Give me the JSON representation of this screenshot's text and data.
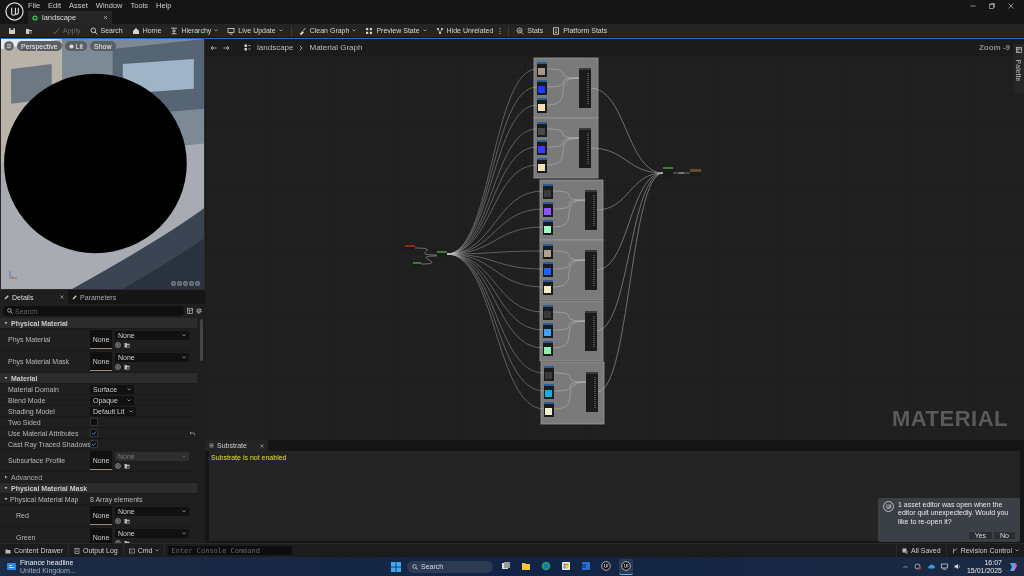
{
  "menu": [
    "File",
    "Edit",
    "Asset",
    "Window",
    "Tools",
    "Help"
  ],
  "document_tab": {
    "label": "landscape",
    "selected": true
  },
  "toolbar": [
    {
      "label": "Apply",
      "disabled": true,
      "dropdown": false,
      "separator_before": false
    },
    {
      "label": "Search",
      "disabled": false,
      "dropdown": false,
      "separator_before": false
    },
    {
      "label": "Home",
      "disabled": false,
      "dropdown": false,
      "separator_before": false
    },
    {
      "label": "Hierarchy",
      "disabled": false,
      "dropdown": true,
      "separator_before": false
    },
    {
      "label": "Live Update",
      "disabled": false,
      "dropdown": true,
      "separator_before": false
    },
    {
      "label": "Clean Graph",
      "disabled": false,
      "dropdown": true,
      "separator_before": true
    },
    {
      "label": "Preview State",
      "disabled": false,
      "dropdown": true,
      "separator_before": false
    },
    {
      "label": "Hide Unrelated",
      "disabled": false,
      "dropdown": false,
      "separator_before": false
    },
    {
      "label": "Stats",
      "disabled": false,
      "dropdown": false,
      "separator_before": true
    },
    {
      "label": "Platform Stats",
      "disabled": false,
      "dropdown": false,
      "separator_before": false
    }
  ],
  "viewport": {
    "buttons": [
      "Perspective",
      "Lit",
      "Show"
    ]
  },
  "details": {
    "tabs": [
      {
        "label": "Details",
        "selected": true
      },
      {
        "label": "Parameters",
        "selected": false
      }
    ],
    "search": {
      "placeholder": "Search"
    },
    "rows": [
      {
        "kind": "section",
        "label": "Physical Material",
        "expanded": true
      },
      {
        "kind": "asset",
        "label": "Phys Material",
        "thumb": "None",
        "value": "None",
        "disabled": false
      },
      {
        "kind": "asset",
        "label": "Phys Material Mask",
        "thumb": "None",
        "value": "None",
        "disabled": false
      },
      {
        "kind": "section",
        "label": "Material",
        "expanded": true
      },
      {
        "kind": "dropdown",
        "label": "Material Domain",
        "value": "Surface"
      },
      {
        "kind": "dropdown",
        "label": "Blend Mode",
        "value": "Opaque"
      },
      {
        "kind": "dropdown",
        "label": "Shading Model",
        "value": "Default Lit"
      },
      {
        "kind": "checkbox",
        "label": "Two Sided",
        "checked": false,
        "modified": false
      },
      {
        "kind": "checkbox",
        "label": "Use Material Attributes",
        "checked": true,
        "modified": true
      },
      {
        "kind": "checkbox",
        "label": "Cast Ray Traced Shadows",
        "checked": true,
        "modified": false
      },
      {
        "kind": "asset",
        "label": "Subsurface Profile",
        "thumb": "None",
        "value": "None",
        "disabled": true
      },
      {
        "kind": "group",
        "label": "Advanced",
        "expanded": false
      },
      {
        "kind": "section",
        "label": "Physical Material Mask",
        "expanded": true
      },
      {
        "kind": "array",
        "label": "Physical Material Map",
        "value": "8 Array elements",
        "expanded": true,
        "children": [
          {
            "kind": "asset",
            "label": "Red",
            "thumb": "None",
            "value": "None",
            "disabled": false
          },
          {
            "kind": "asset",
            "label": "Green",
            "thumb": "None",
            "value": "None",
            "disabled": false
          }
        ]
      }
    ]
  },
  "graph": {
    "breadcrumb": [
      "landscape",
      "Material Graph"
    ],
    "zoom": "Zoom -9",
    "palette": "Palette",
    "watermark": "MATERIAL"
  },
  "substrate": {
    "tab": "Substrate",
    "message": "Substrate is not enabled"
  },
  "notification": {
    "message": "1 asset editor was open when the editor quit unexpectedly. Would you like to re-open it?",
    "buttons": [
      "Yes",
      "No"
    ]
  },
  "status_bar": {
    "left": [
      {
        "label": "Content Drawer",
        "dropdown": false
      },
      {
        "label": "Output Log",
        "dropdown": false
      },
      {
        "label": "Cmd",
        "dropdown": true
      }
    ],
    "console": {
      "placeholder": "Enter Console Command"
    },
    "right": [
      {
        "label": "All Saved",
        "dropdown": false
      },
      {
        "label": "Revision Control",
        "dropdown": true
      }
    ]
  },
  "taskbar": {
    "widget": {
      "title": "Finance headline",
      "subtitle": "United Kingdom..."
    },
    "search": {
      "placeholder": "Search"
    },
    "apps": [
      {
        "selected": false
      },
      {
        "selected": false
      },
      {
        "selected": false
      },
      {
        "selected": false
      },
      {
        "selected": false
      },
      {
        "selected": false
      },
      {
        "selected": true
      }
    ],
    "time": "16:07",
    "date": "15/01/2025"
  }
}
